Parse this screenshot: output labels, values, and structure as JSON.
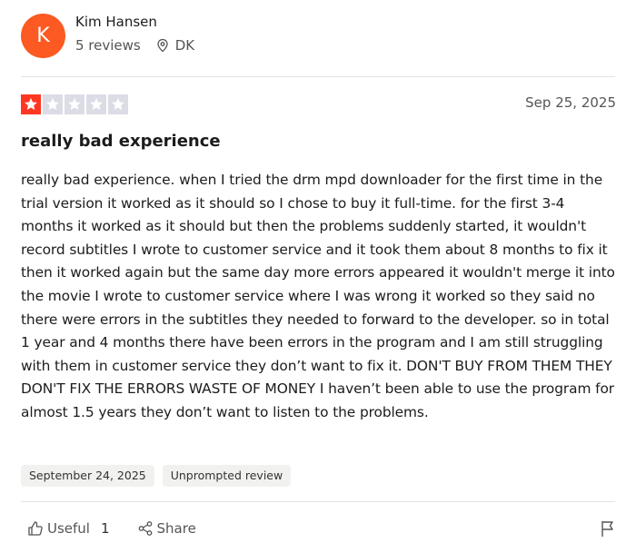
{
  "reviewer": {
    "initial": "K",
    "name": "Kim Hansen",
    "reviews_count": "5 reviews",
    "country": "DK",
    "avatar_color": "#fc5a22"
  },
  "review": {
    "rating": 1,
    "max_rating": 5,
    "date": "Sep 25, 2025",
    "title": "really bad experience",
    "body": "really bad experience. when I tried the drm mpd downloader for the first time in the trial version it worked as it should so I chose to buy it full-time. for the first 3-4 months it worked as it should but then the problems suddenly started, it wouldn't record subtitles I wrote to customer service and it took them about 8 months to fix it then it worked again but the same day more errors appeared it wouldn't merge it into the movie I wrote to customer service where I was wrong it worked so they said no there were errors in the subtitles they needed to forward to the developer. so in total 1 year and 4 months there have been errors in the program and I am still struggling with them in customer service they don’t want to fix it. DON'T BUY FROM THEM THEY DON'T FIX THE ERRORS WASTE OF MONEY I haven’t been able to use the program for almost 1.5 years they don’t want to listen to the problems.",
    "experience_date": "September 24, 2025",
    "review_type": "Unprompted review",
    "star_filled_color": "#ff3722",
    "star_empty_color": "#dcdce6"
  },
  "actions": {
    "useful_label": "Useful",
    "useful_count": "1",
    "share_label": "Share",
    "icons": [
      "thumbs-up-icon",
      "share-icon",
      "flag-icon",
      "location-pin-icon"
    ]
  }
}
